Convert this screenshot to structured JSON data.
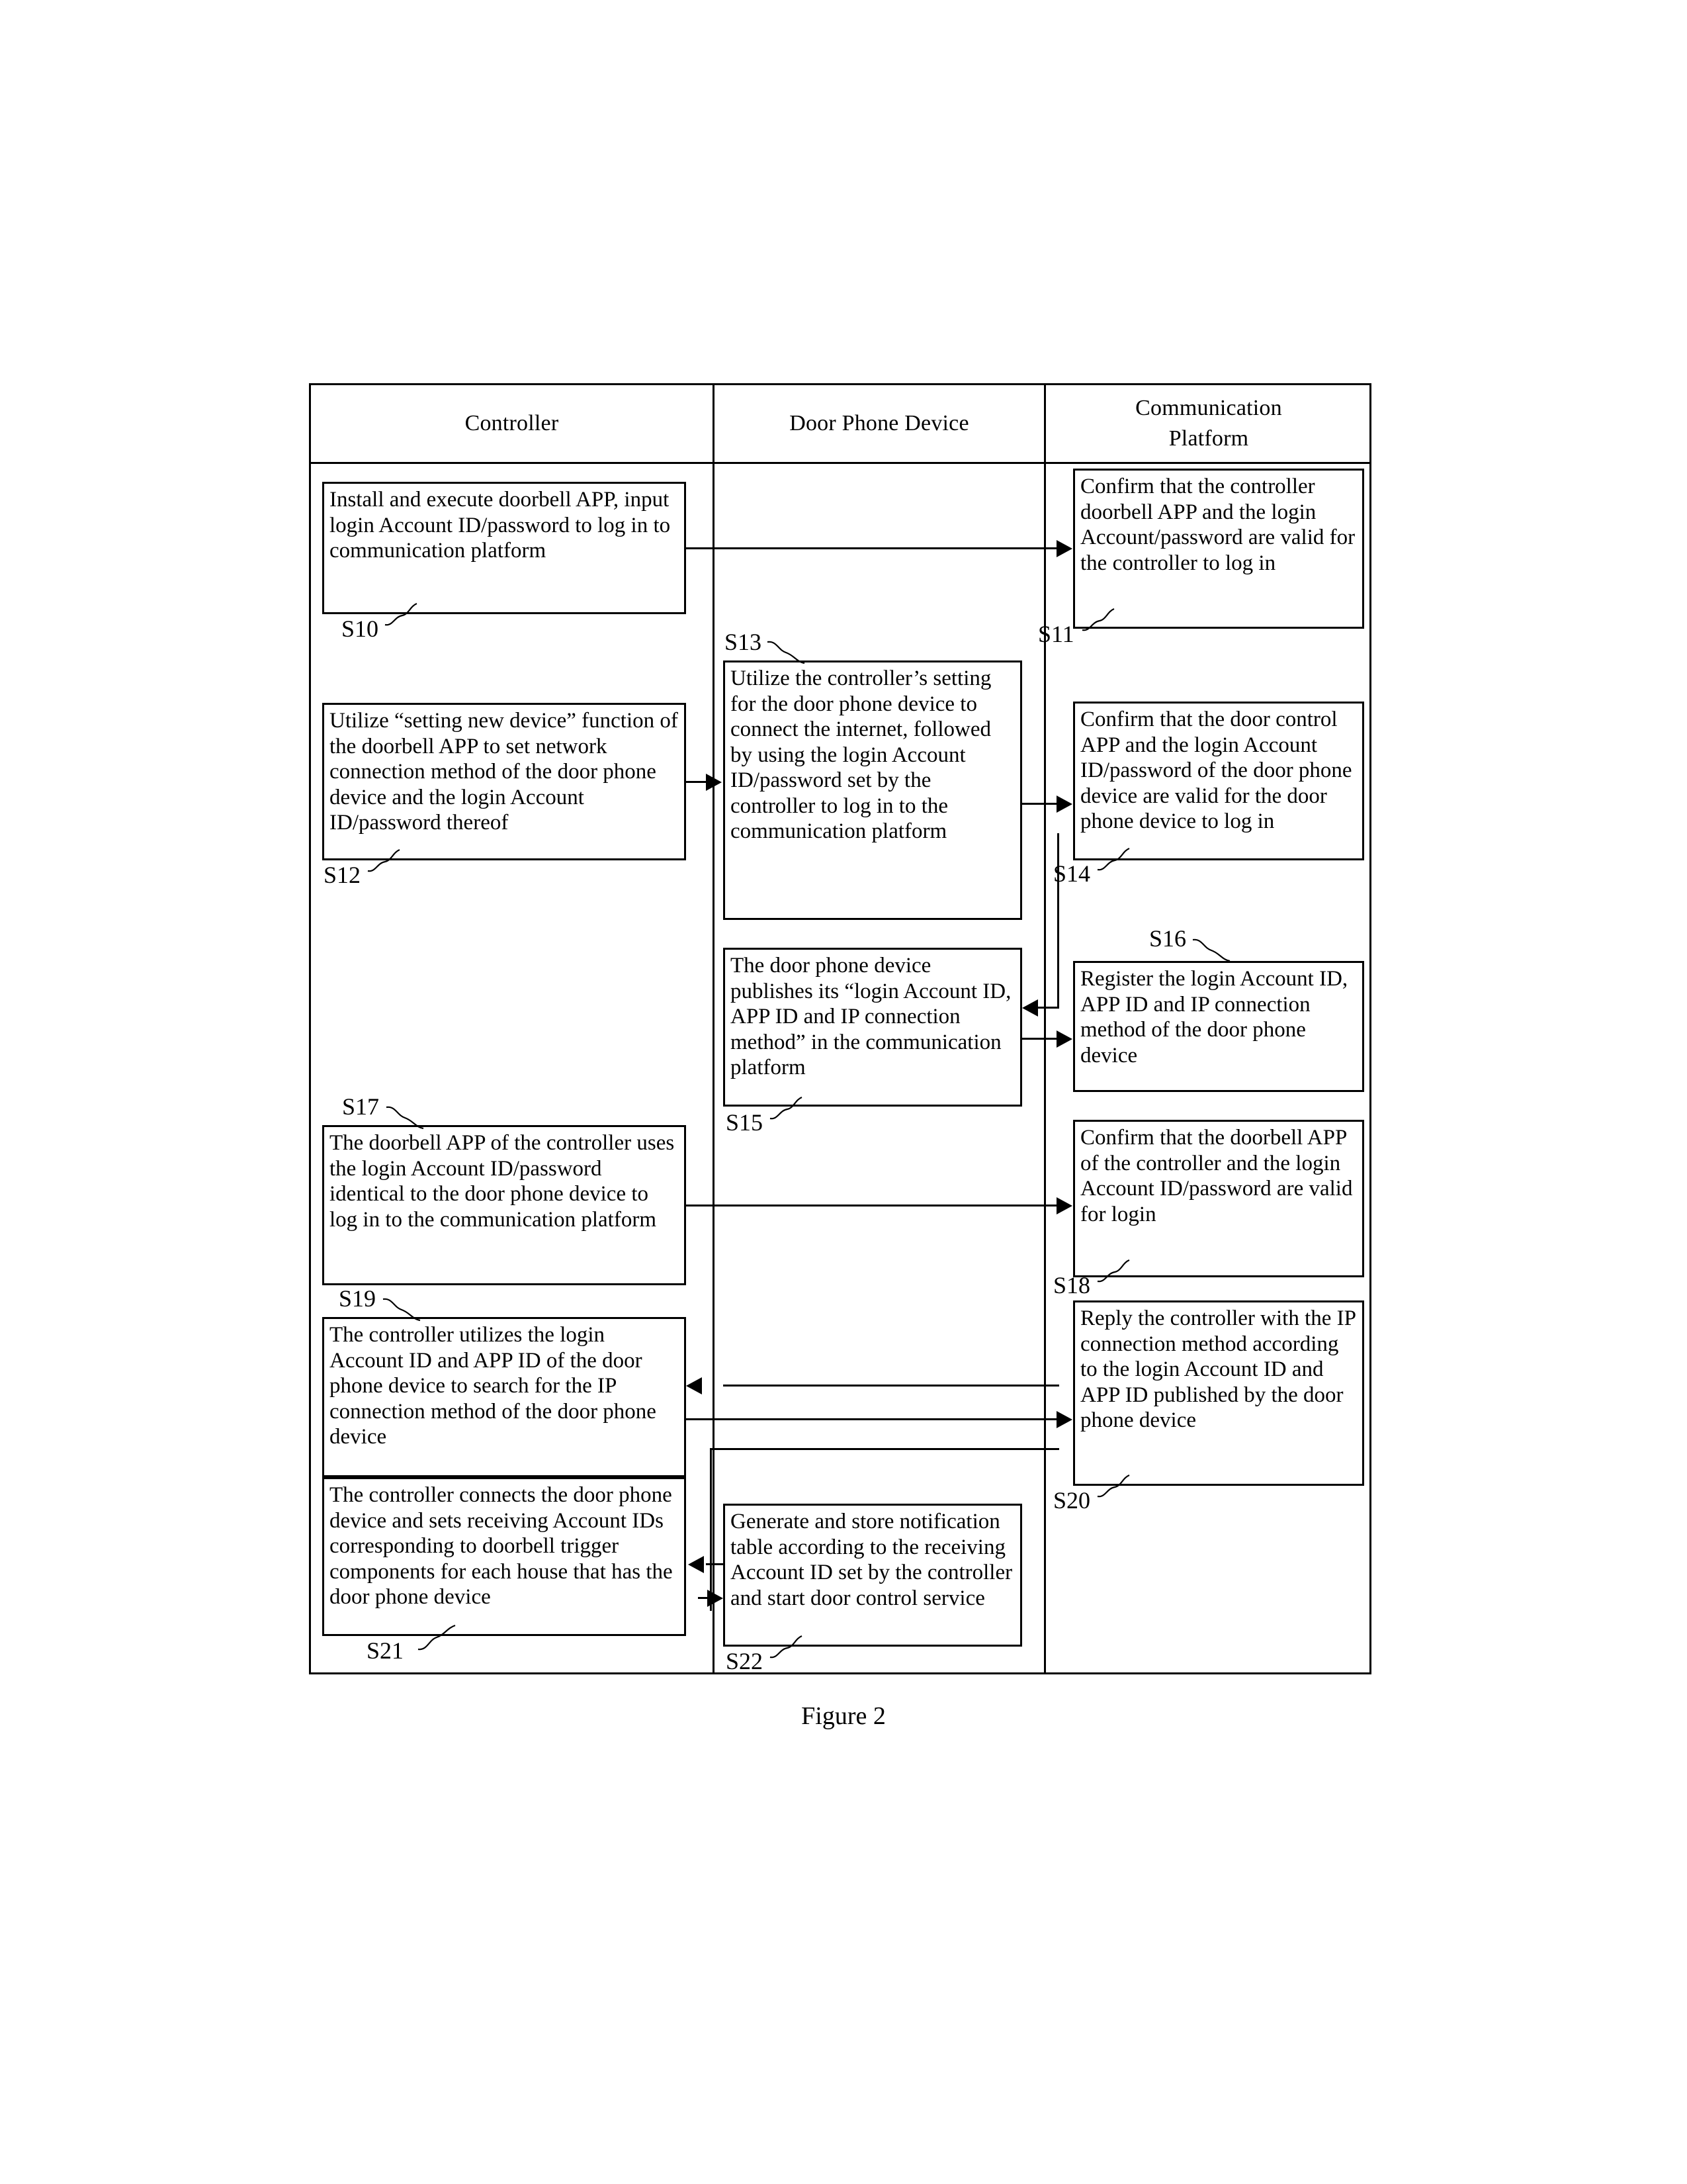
{
  "figure": {
    "caption": "Figure 2"
  },
  "lanes": [
    {
      "id": "controller",
      "title": "Controller"
    },
    {
      "id": "door-phone",
      "title": "Door Phone Device"
    },
    {
      "id": "comm-platform",
      "title": "Communication\nPlatform"
    }
  ],
  "steps": {
    "s10": {
      "ref": "S10",
      "lane": "controller",
      "text": "Install and execute doorbell APP, input login Account ID/password to log in to communication platform"
    },
    "s11": {
      "ref": "S11",
      "lane": "comm-platform",
      "text": "Confirm that the controller doorbell APP and the login Account/password are valid for the controller to log in"
    },
    "s12": {
      "ref": "S12",
      "lane": "controller",
      "text": "Utilize “setting new device” function of the doorbell APP to set network connection method of the door phone device and the login Account ID/password thereof"
    },
    "s13": {
      "ref": "S13",
      "lane": "door-phone",
      "text": "Utilize the controller’s setting for the door phone device to connect the internet, followed by using the login Account ID/password set by the controller to log in to the communication platform"
    },
    "s14": {
      "ref": "S14",
      "lane": "comm-platform",
      "text": "Confirm that the door control APP and the login Account ID/password of the door phone device are valid for the door phone device to log in"
    },
    "s15": {
      "ref": "S15",
      "lane": "door-phone",
      "text": "The door phone device publishes its “login Account ID, APP ID and IP connection method” in the communication platform"
    },
    "s16": {
      "ref": "S16",
      "lane": "comm-platform",
      "text": "Register the login Account ID, APP ID and IP connection method of the door phone device"
    },
    "s17": {
      "ref": "S17",
      "lane": "controller",
      "text": "The doorbell APP of the controller uses the login Account ID/password identical to the door phone device to log in to the communication platform"
    },
    "s18": {
      "ref": "S18",
      "lane": "comm-platform",
      "text": "Confirm that the doorbell APP of the controller and the login Account ID/password are valid for login"
    },
    "s19": {
      "ref": "S19",
      "lane": "controller",
      "text": "The controller utilizes the login Account ID and APP ID of the door phone device to search for the IP connection method of the door phone device"
    },
    "s20": {
      "ref": "S20",
      "lane": "comm-platform",
      "text": "Reply the controller with the IP connection method according to the login Account ID and APP ID published by the door phone device"
    },
    "s21": {
      "ref": "S21",
      "lane": "controller",
      "text": "The controller connects the door phone device and sets receiving Account IDs corresponding to doorbell trigger components for each house that has the door phone device"
    },
    "s22": {
      "ref": "S22",
      "lane": "door-phone",
      "text": "Generate and store notification table according to the receiving Account ID set by the controller and start door control service"
    }
  },
  "colors": {
    "line": "#000000",
    "background": "#ffffff"
  }
}
